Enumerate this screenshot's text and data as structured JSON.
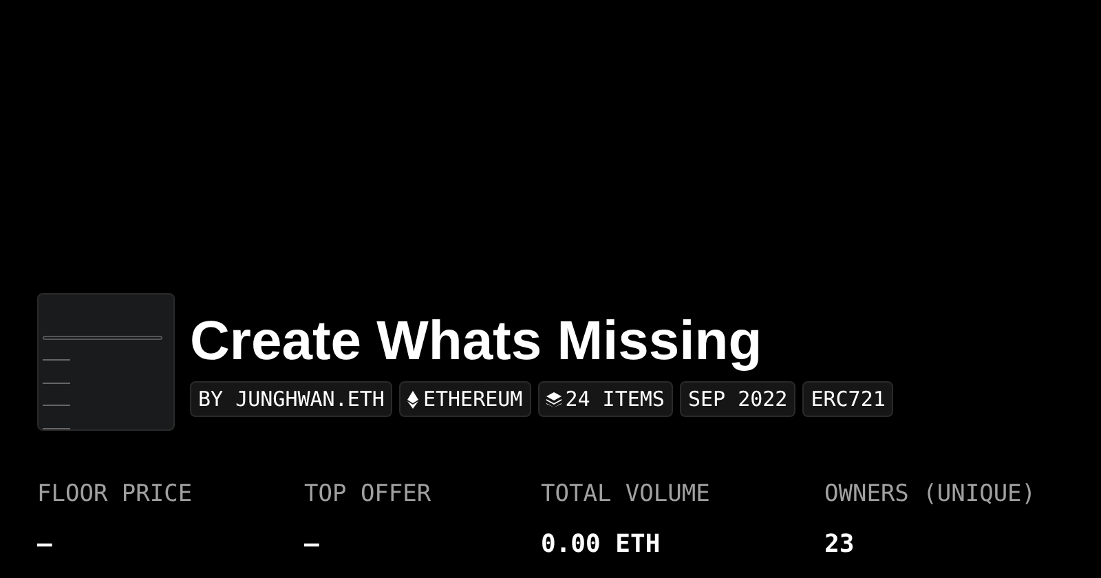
{
  "collection": {
    "title": "Create Whats Missing"
  },
  "tags": [
    {
      "kind": "plain",
      "text": "BY JUNGHWAN.ETH"
    },
    {
      "kind": "chain",
      "text": "ETHEREUM"
    },
    {
      "kind": "items",
      "text": "24 ITEMS"
    },
    {
      "kind": "plain",
      "text": "SEP 2022"
    },
    {
      "kind": "plain",
      "text": "ERC721"
    }
  ],
  "stats": [
    {
      "label": "FLOOR PRICE",
      "value": "—"
    },
    {
      "label": "TOP OFFER",
      "value": "—"
    },
    {
      "label": "TOTAL VOLUME",
      "value": "0.00 ETH"
    },
    {
      "label": "OWNERS (UNIQUE)",
      "value": "23"
    }
  ]
}
